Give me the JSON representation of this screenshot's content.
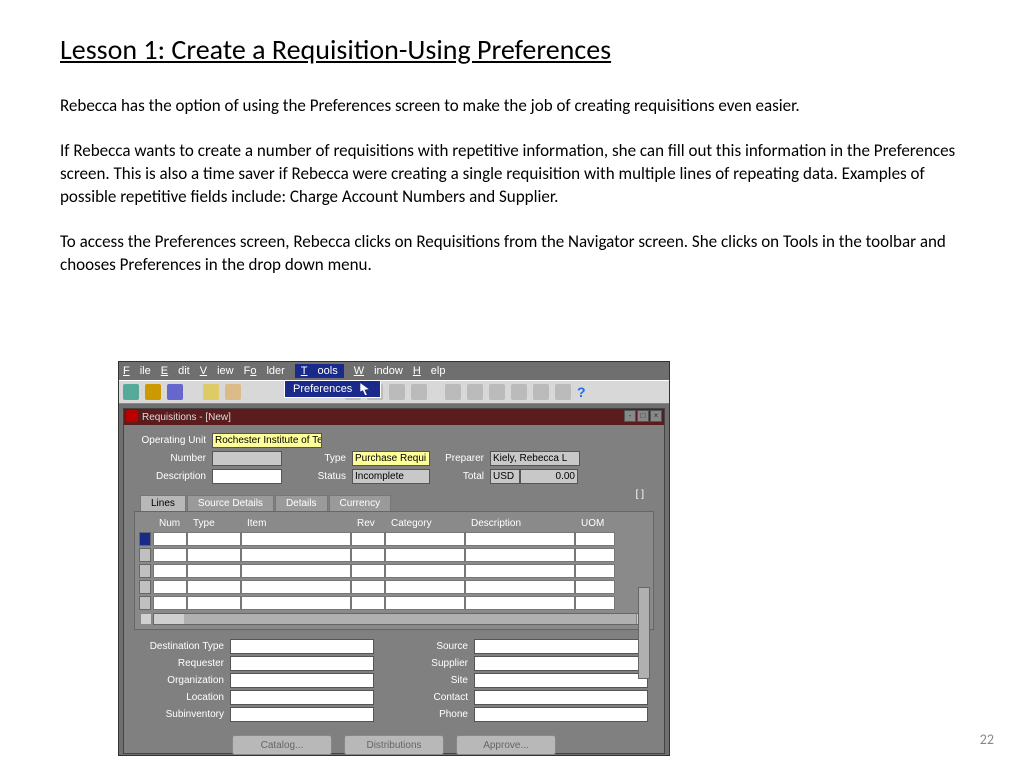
{
  "title": "Lesson 1:  Create a Requisition-Using Preferences",
  "para1": "Rebecca has the option of using the Preferences screen to make the job of creating requisitions even easier.",
  "para2": "If Rebecca wants to create a number of requisitions with repetitive information, she can fill out this information in the Preferences screen.  This is also a time saver if Rebecca were creating a single requisition with multiple lines of repeating data.  Examples of possible repetitive fields include: Charge Account Numbers and Supplier.",
  "para3": "To access the Preferences screen, Rebecca clicks on Requisitions from the Navigator screen.  She clicks on Tools in the toolbar and chooses Preferences in the drop down menu.",
  "page_num": "22",
  "menu": {
    "file": "File",
    "edit": "Edit",
    "view": "View",
    "folder": "Folder",
    "tools": "Tools",
    "window": "Window",
    "help": "Help"
  },
  "dropdown_item": "Preferences",
  "subwin_title": "Requisitions - [New]",
  "form": {
    "op_unit_lbl": "Operating Unit",
    "op_unit": "Rochester Institute of Te",
    "number_lbl": "Number",
    "number": "",
    "desc_lbl": "Description",
    "desc": "",
    "type_lbl": "Type",
    "type": "Purchase Requi",
    "status_lbl": "Status",
    "status": "Incomplete",
    "preparer_lbl": "Preparer",
    "preparer": "Kiely, Rebecca L",
    "total_lbl": "Total",
    "total_cur": "USD",
    "total_amt": "0.00"
  },
  "tabs": {
    "lines": "Lines",
    "source": "Source Details",
    "details": "Details",
    "currency": "Currency"
  },
  "cols": {
    "num": "Num",
    "type": "Type",
    "item": "Item",
    "rev": "Rev",
    "category": "Category",
    "desc": "Description",
    "uom": "UOM"
  },
  "bottom_left": {
    "dest": "Destination Type",
    "req": "Requester",
    "org": "Organization",
    "loc": "Location",
    "sub": "Subinventory"
  },
  "bottom_right": {
    "src": "Source",
    "sup": "Supplier",
    "site": "Site",
    "contact": "Contact",
    "phone": "Phone"
  },
  "buttons": {
    "catalog": "Catalog...",
    "dist": "Distributions",
    "approve": "Approve..."
  },
  "bracket": "[     ]"
}
